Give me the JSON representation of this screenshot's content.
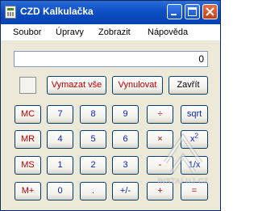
{
  "window": {
    "title": "CZD Kalkulačka",
    "icon": "calculator-app-icon"
  },
  "menu": {
    "items": [
      "Soubor",
      "Úpravy",
      "Zobrazit",
      "Nápověda"
    ]
  },
  "display": {
    "value": "0"
  },
  "actions": {
    "clear_entry": "Vymazat vše",
    "reset": "Vynulovat",
    "close": "Zavřít"
  },
  "memory": {
    "mc": "MC",
    "mr": "MR",
    "ms": "MS",
    "mplus": "M+"
  },
  "keys": {
    "k7": "7",
    "k8": "8",
    "k9": "9",
    "k4": "4",
    "k5": "5",
    "k6": "6",
    "k1": "1",
    "k2": "2",
    "k3": "3",
    "k0": "0",
    "dot": ".",
    "sign": "+/-",
    "divide": "÷",
    "multiply": "×",
    "minus": "-",
    "plus": "+",
    "sqrt": "sqrt",
    "square_base": "x",
    "square_exp": "2",
    "reciprocal": "1/x",
    "equals": "="
  },
  "watermark": {
    "text": "INSTALUJ.CZ"
  },
  "colors": {
    "title_bar": "#0d4fc4",
    "memory_keys": "#b80000",
    "digit_keys": "#0a24b0",
    "client_background": "#ece9d8"
  }
}
